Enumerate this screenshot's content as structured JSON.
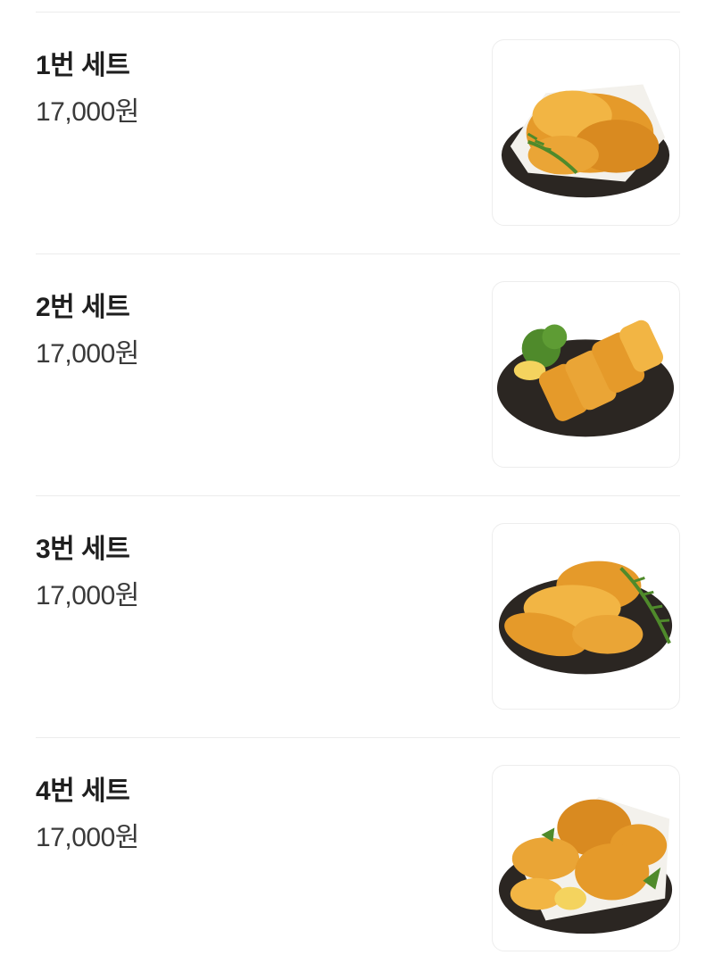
{
  "menu": {
    "items": [
      {
        "name": "1번 세트",
        "price": "17,000원",
        "image": "fried-cutlet-platter-icon"
      },
      {
        "name": "2번 세트",
        "price": "17,000원",
        "image": "sliced-cutlet-platter-icon"
      },
      {
        "name": "3번 세트",
        "price": "17,000원",
        "image": "fried-tender-platter-icon"
      },
      {
        "name": "4번 세트",
        "price": "17,000원",
        "image": "mixed-cutlet-platter-icon"
      }
    ]
  },
  "colors": {
    "plate": "#2b2622",
    "crust": "#e59a2a",
    "crust_light": "#f2b544",
    "garnish": "#4f8a2b",
    "lemon": "#f4d35e",
    "divider": "#ececec"
  }
}
